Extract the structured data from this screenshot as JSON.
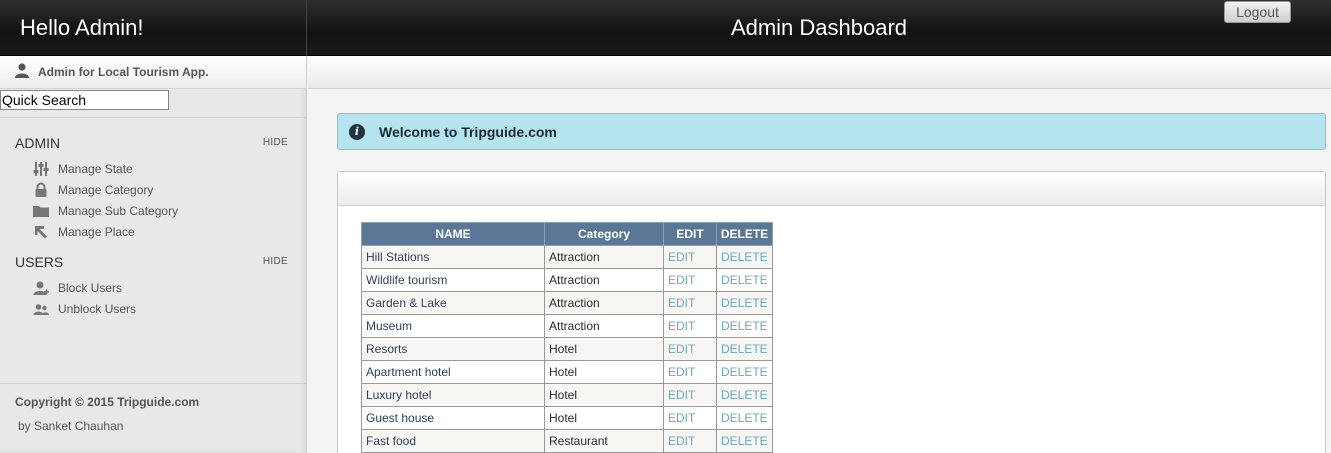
{
  "header": {
    "greeting": "Hello Admin!",
    "title": "Admin Dashboard",
    "logout_label": "Logout"
  },
  "sidebar": {
    "user_label": "Admin for Local Tourism App.",
    "search": {
      "placeholder": "Quick Search",
      "value": ""
    },
    "sections": [
      {
        "title": "ADMIN",
        "hide_label": "HIDE",
        "items": [
          {
            "label": "Manage State",
            "icon": "sliders-icon"
          },
          {
            "label": "Manage Category",
            "icon": "lock-icon"
          },
          {
            "label": "Manage Sub Category",
            "icon": "folder-icon"
          },
          {
            "label": "Manage Place",
            "icon": "arrow-icon"
          }
        ]
      },
      {
        "title": "USERS",
        "hide_label": "HIDE",
        "items": [
          {
            "label": "Block Users",
            "icon": "user-add-icon"
          },
          {
            "label": "Unblock Users",
            "icon": "users-icon"
          }
        ]
      }
    ],
    "copyright": "Copyright © 2015 Tripguide.com",
    "byline": "by Sanket Chauhan"
  },
  "main": {
    "welcome": "Welcome to Tripguide.com",
    "table": {
      "columns": [
        "NAME",
        "Category",
        "EDIT",
        "DELETE"
      ],
      "rows": [
        {
          "name": "Hill Stations",
          "category": "Attraction",
          "edit": "EDIT",
          "delete": "DELETE"
        },
        {
          "name": "Wildlife tourism",
          "category": "Attraction",
          "edit": "EDIT",
          "delete": "DELETE"
        },
        {
          "name": "Garden & Lake",
          "category": "Attraction",
          "edit": "EDIT",
          "delete": "DELETE"
        },
        {
          "name": "Museum",
          "category": "Attraction",
          "edit": "EDIT",
          "delete": "DELETE"
        },
        {
          "name": "Resorts",
          "category": "Hotel",
          "edit": "EDIT",
          "delete": "DELETE"
        },
        {
          "name": "Apartment hotel",
          "category": "Hotel",
          "edit": "EDIT",
          "delete": "DELETE"
        },
        {
          "name": "Luxury hotel",
          "category": "Hotel",
          "edit": "EDIT",
          "delete": "DELETE"
        },
        {
          "name": "Guest house",
          "category": "Hotel",
          "edit": "EDIT",
          "delete": "DELETE"
        },
        {
          "name": "Fast food",
          "category": "Restaurant",
          "edit": "EDIT",
          "delete": "DELETE"
        }
      ]
    }
  },
  "colors": {
    "header_bg": "#1b1b1b",
    "table_header": "#5a7896",
    "welcome_bg": "#b5e3ee",
    "action_link": "#6aa8bf"
  }
}
